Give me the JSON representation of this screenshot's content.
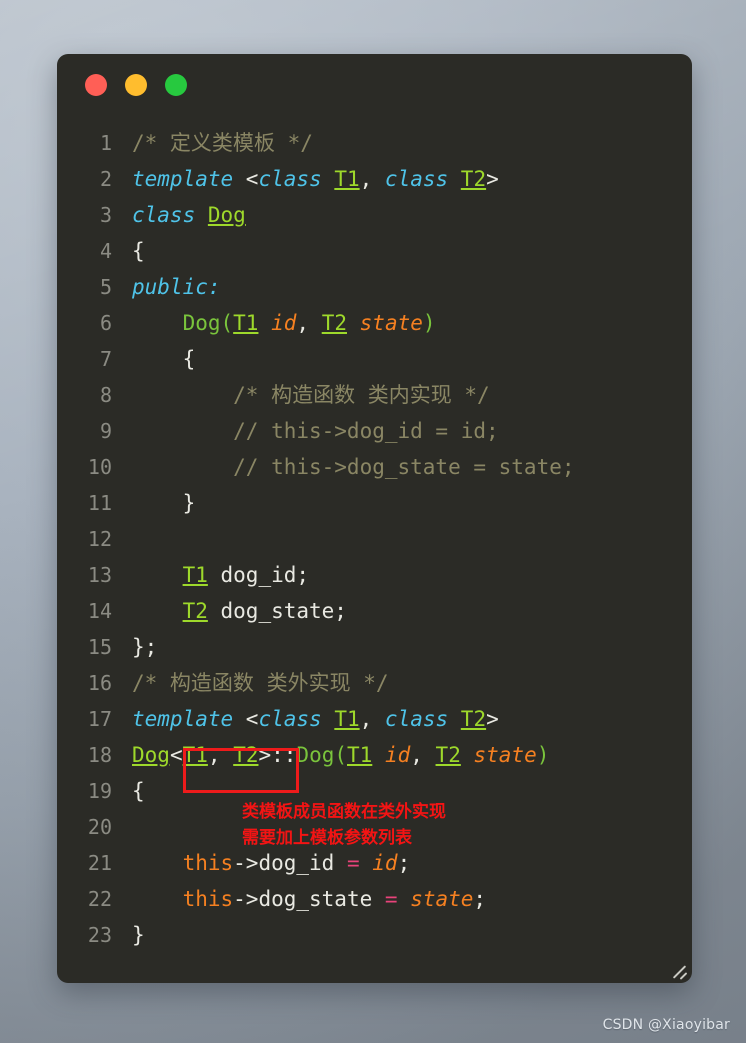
{
  "window": {
    "title": "code-snippet-window",
    "buttons": [
      {
        "name": "close",
        "color": "#ff5f56"
      },
      {
        "name": "minimize",
        "color": "#ffbd2e"
      },
      {
        "name": "maximize",
        "color": "#27c93f"
      }
    ],
    "resize_grip": "resize-grip"
  },
  "editor": {
    "language": "cpp",
    "theme_background": "#2b2b26",
    "colors": {
      "comment": "#8a8664",
      "keyword": "#4fc3e8",
      "type": "#9ed92b",
      "function": "#7ac43c",
      "variable": "#f58021",
      "plain": "#e9e9e2",
      "operator": "#e9437b",
      "line_number": "#8b8b83"
    },
    "lines": [
      {
        "n": "1",
        "text": "/* 定义类模板 */"
      },
      {
        "n": "2",
        "text": "template <class T1, class T2>"
      },
      {
        "n": "3",
        "text": "class Dog"
      },
      {
        "n": "4",
        "text": "{"
      },
      {
        "n": "5",
        "text": "public:"
      },
      {
        "n": "6",
        "text": "    Dog(T1 id, T2 state)"
      },
      {
        "n": "7",
        "text": "    {"
      },
      {
        "n": "8",
        "text": "        /* 构造函数 类内实现 */"
      },
      {
        "n": "9",
        "text": "        // this->dog_id = id;"
      },
      {
        "n": "10",
        "text": "        // this->dog_state = state;"
      },
      {
        "n": "11",
        "text": "    }"
      },
      {
        "n": "12",
        "text": ""
      },
      {
        "n": "13",
        "text": "    T1 dog_id;"
      },
      {
        "n": "14",
        "text": "    T2 dog_state;"
      },
      {
        "n": "15",
        "text": "};"
      },
      {
        "n": "16",
        "text": "/* 构造函数 类外实现 */"
      },
      {
        "n": "17",
        "text": "template <class T1, class T2>"
      },
      {
        "n": "18",
        "text": "Dog<T1, T2>::Dog(T1 id, T2 state)"
      },
      {
        "n": "19",
        "text": "{"
      },
      {
        "n": "20",
        "text": ""
      },
      {
        "n": "21",
        "text": "    this->dog_id = id;"
      },
      {
        "n": "22",
        "text": "    this->dog_state = state;"
      },
      {
        "n": "23",
        "text": "}"
      }
    ]
  },
  "annotation": {
    "highlight_target": "<T1, T2>",
    "highlight_color": "#ee1b1b",
    "text_color": "#f31414",
    "line1": "类模板成员函数在类外实现",
    "line2": "需要加上模板参数列表"
  },
  "watermark": {
    "text": "CSDN @Xiaoyibar"
  }
}
